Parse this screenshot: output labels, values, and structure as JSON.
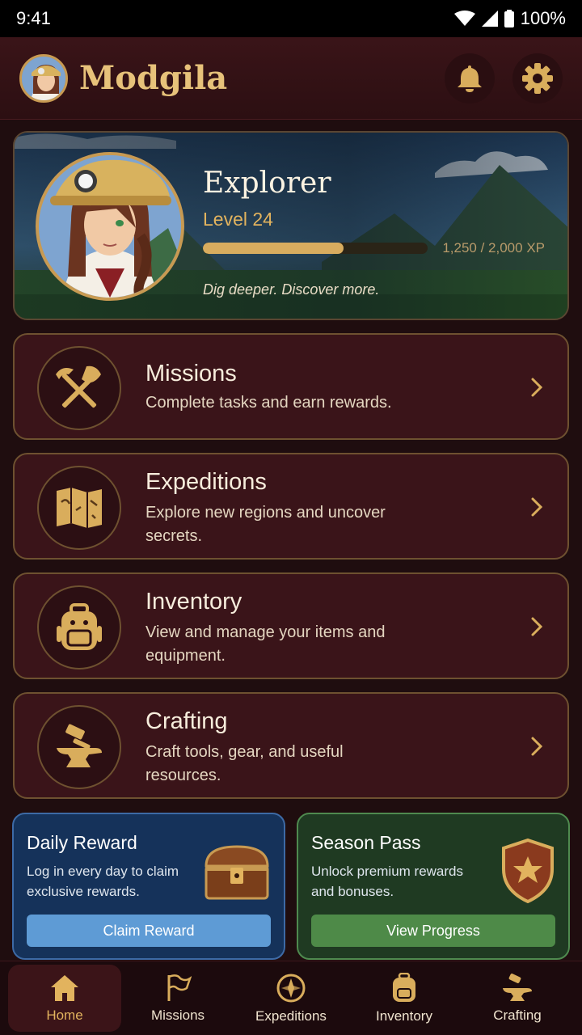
{
  "status": {
    "time": "9:41",
    "battery": "100%"
  },
  "header": {
    "title": "Modgila"
  },
  "profile": {
    "name": "Explorer",
    "level": "Level 24",
    "xp_text": "1,250 / 2,000 XP",
    "xp_progress": 0.625,
    "tagline": "Dig deeper. Discover more."
  },
  "menu": [
    {
      "title": "Missions",
      "desc": "Complete tasks and earn rewards.",
      "icon": "shovel-pickaxe-icon"
    },
    {
      "title": "Expeditions",
      "desc": "Explore new regions and uncover secrets.",
      "icon": "map-icon"
    },
    {
      "title": "Inventory",
      "desc": "View and manage your items and equipment.",
      "icon": "backpack-icon"
    },
    {
      "title": "Crafting",
      "desc": "Craft tools, gear, and useful resources.",
      "icon": "anvil-icon"
    }
  ],
  "promos": {
    "daily": {
      "title": "Daily Reward",
      "desc": "Log in every day to claim exclusive rewards.",
      "button": "Claim Reward"
    },
    "season": {
      "title": "Season Pass",
      "desc": "Unlock premium rewards and bonuses.",
      "button": "View Progress"
    }
  },
  "nav": [
    {
      "label": "Home",
      "active": true
    },
    {
      "label": "Missions",
      "active": false
    },
    {
      "label": "Expeditions",
      "active": false
    },
    {
      "label": "Inventory",
      "active": false
    },
    {
      "label": "Crafting",
      "active": false
    }
  ],
  "colors": {
    "accent": "#e2b35e",
    "background": "#1f0d0f",
    "card": "#3a1419",
    "border": "#6e5130"
  }
}
